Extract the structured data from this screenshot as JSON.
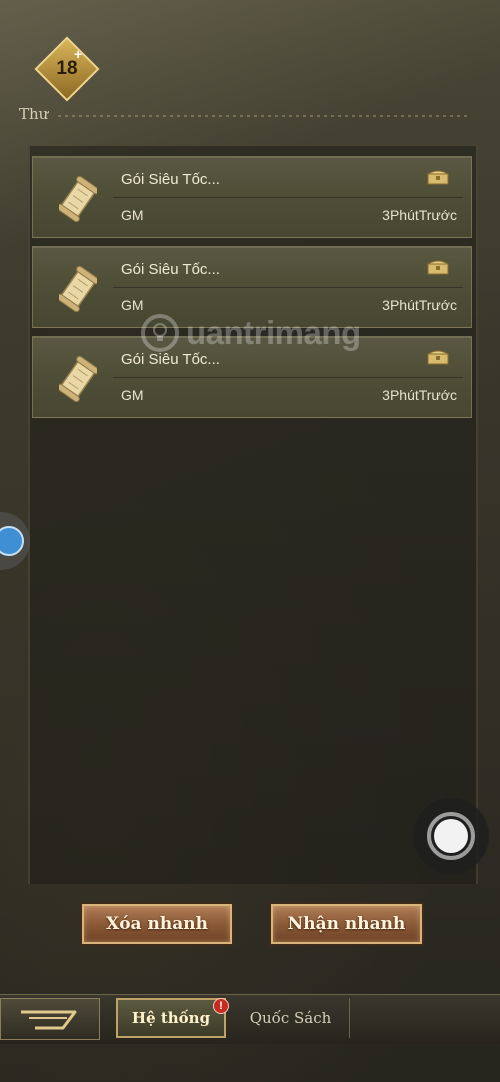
{
  "age_rating": {
    "number": "18",
    "plus": "+"
  },
  "mail": {
    "title": "Thư",
    "items": [
      {
        "subject": "Gói Siêu Tốc...",
        "sender": "GM",
        "time": "3PhútTrước",
        "attachment_icon": "chest-icon",
        "item_icon": "scroll-icon"
      },
      {
        "subject": "Gói Siêu Tốc...",
        "sender": "GM",
        "time": "3PhútTrước",
        "attachment_icon": "chest-icon",
        "item_icon": "scroll-icon"
      },
      {
        "subject": "Gói Siêu Tốc...",
        "sender": "GM",
        "time": "3PhútTrước",
        "attachment_icon": "chest-icon",
        "item_icon": "scroll-icon"
      }
    ]
  },
  "actions": {
    "delete_label": "Xóa nhanh",
    "receive_label": "Nhận nhanh"
  },
  "tabs": [
    {
      "label": "Hệ thống",
      "active": true,
      "badge": "!"
    },
    {
      "label": "Quốc Sách",
      "active": false
    }
  ],
  "watermark": {
    "text": "uantrimang"
  },
  "colors": {
    "accent_gold": "#d8b47a",
    "button_brown": "#8b5a37",
    "badge_red": "#c62b1f",
    "item_bg": "#505039"
  }
}
